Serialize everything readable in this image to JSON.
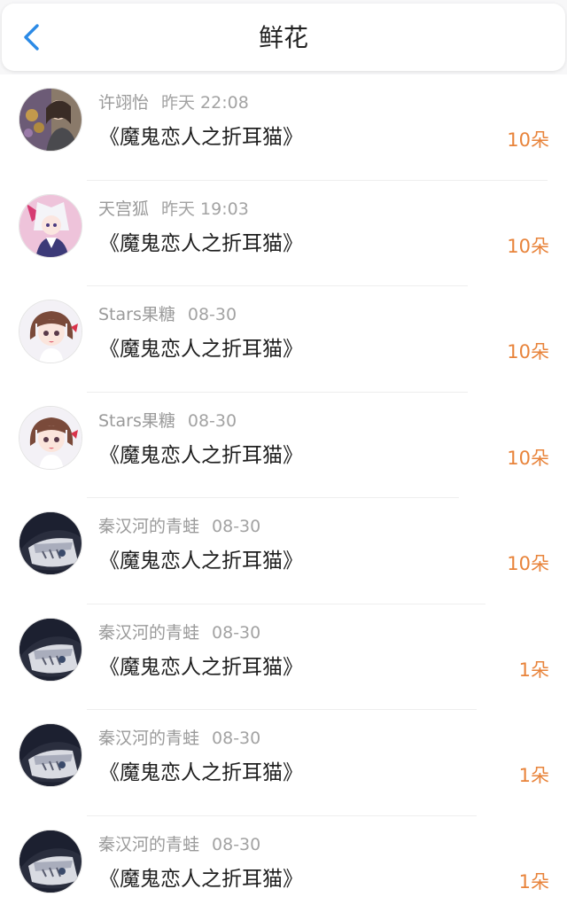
{
  "header": {
    "title": "鲜花",
    "back_icon": "chevron-left-icon",
    "accent_color": "#2b8ae6"
  },
  "flowers": [
    {
      "user": "许翊怡",
      "time": "昨天 22:08",
      "work": "《魔鬼恋人之折耳猫》",
      "count": "10朵",
      "avatar": "photo-avatar"
    },
    {
      "user": "天宫狐",
      "time": "昨天 19:03",
      "work": "《魔鬼恋人之折耳猫》",
      "count": "10朵",
      "avatar": "anime-fox-avatar"
    },
    {
      "user": "Stars果糖",
      "time": "08-30",
      "work": "《魔鬼恋人之折耳猫》",
      "count": "10朵",
      "avatar": "anime-girl-avatar"
    },
    {
      "user": "Stars果糖",
      "time": "08-30",
      "work": "《魔鬼恋人之折耳猫》",
      "count": "10朵",
      "avatar": "anime-girl-avatar"
    },
    {
      "user": "秦汉河的青蛙",
      "time": "08-30",
      "work": "《魔鬼恋人之折耳猫》",
      "count": "10朵",
      "avatar": "anime-dark-avatar"
    },
    {
      "user": "秦汉河的青蛙",
      "time": "08-30",
      "work": "《魔鬼恋人之折耳猫》",
      "count": "1朵",
      "avatar": "anime-dark-avatar"
    },
    {
      "user": "秦汉河的青蛙",
      "time": "08-30",
      "work": "《魔鬼恋人之折耳猫》",
      "count": "1朵",
      "avatar": "anime-dark-avatar"
    },
    {
      "user": "秦汉河的青蛙",
      "time": "08-30",
      "work": "《魔鬼恋人之折耳猫》",
      "count": "1朵",
      "avatar": "anime-dark-avatar"
    }
  ],
  "colors": {
    "count": "#e8833a",
    "username": "#9a9a9a",
    "work_title": "#1f1f1f"
  }
}
